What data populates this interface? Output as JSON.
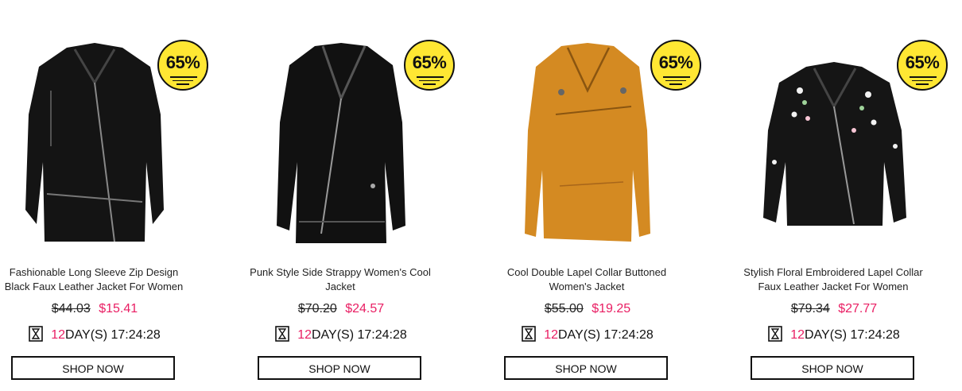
{
  "products": [
    {
      "title": "Fashionable Long Sleeve Zip Design Black Faux Leather Jacket For Women",
      "old_price": "$44.03",
      "new_price": "$15.41",
      "discount": "65%",
      "days": "12",
      "days_label": "DAY(S)",
      "time": "17:24:28",
      "button": "SHOP NOW",
      "jacket_color": "#141414"
    },
    {
      "title": "Punk Style Side Strappy Women's Cool Jacket",
      "old_price": "$70.20",
      "new_price": "$24.57",
      "discount": "65%",
      "days": "12",
      "days_label": "DAY(S)",
      "time": "17:24:28",
      "button": "SHOP NOW",
      "jacket_color": "#111111"
    },
    {
      "title": "Cool Double Lapel Collar Buttoned Women's Jacket",
      "old_price": "$55.00",
      "new_price": "$19.25",
      "discount": "65%",
      "days": "12",
      "days_label": "DAY(S)",
      "time": "17:24:28",
      "button": "SHOP NOW",
      "jacket_color": "#d48a22"
    },
    {
      "title": "Stylish Floral Embroidered Lapel Collar Faux Leather Jacket For Women",
      "old_price": "$79.34",
      "new_price": "$27.77",
      "discount": "65%",
      "days": "12",
      "days_label": "DAY(S)",
      "time": "17:24:28",
      "button": "SHOP NOW",
      "jacket_color": "#151515"
    }
  ],
  "colors": {
    "sale_price": "#e91e63",
    "badge": "#ffe733"
  },
  "icons": {
    "timer": "hourglass-icon"
  }
}
